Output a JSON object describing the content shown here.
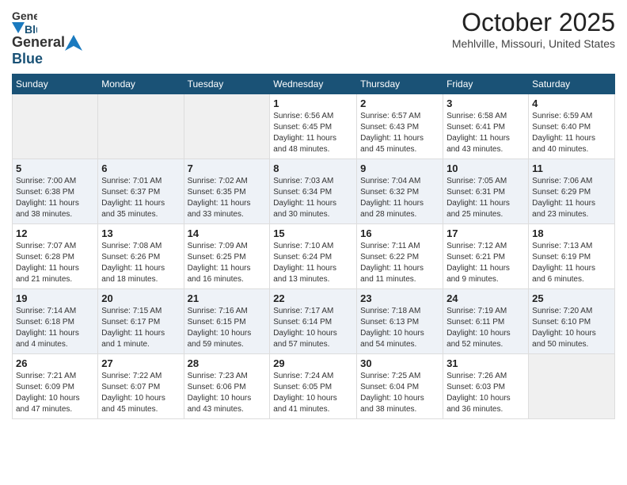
{
  "header": {
    "logo_general": "General",
    "logo_blue": "Blue",
    "month_title": "October 2025",
    "location": "Mehlville, Missouri, United States"
  },
  "days_of_week": [
    "Sunday",
    "Monday",
    "Tuesday",
    "Wednesday",
    "Thursday",
    "Friday",
    "Saturday"
  ],
  "weeks": [
    [
      {
        "day": "",
        "info": ""
      },
      {
        "day": "",
        "info": ""
      },
      {
        "day": "",
        "info": ""
      },
      {
        "day": "1",
        "info": "Sunrise: 6:56 AM\nSunset: 6:45 PM\nDaylight: 11 hours\nand 48 minutes."
      },
      {
        "day": "2",
        "info": "Sunrise: 6:57 AM\nSunset: 6:43 PM\nDaylight: 11 hours\nand 45 minutes."
      },
      {
        "day": "3",
        "info": "Sunrise: 6:58 AM\nSunset: 6:41 PM\nDaylight: 11 hours\nand 43 minutes."
      },
      {
        "day": "4",
        "info": "Sunrise: 6:59 AM\nSunset: 6:40 PM\nDaylight: 11 hours\nand 40 minutes."
      }
    ],
    [
      {
        "day": "5",
        "info": "Sunrise: 7:00 AM\nSunset: 6:38 PM\nDaylight: 11 hours\nand 38 minutes."
      },
      {
        "day": "6",
        "info": "Sunrise: 7:01 AM\nSunset: 6:37 PM\nDaylight: 11 hours\nand 35 minutes."
      },
      {
        "day": "7",
        "info": "Sunrise: 7:02 AM\nSunset: 6:35 PM\nDaylight: 11 hours\nand 33 minutes."
      },
      {
        "day": "8",
        "info": "Sunrise: 7:03 AM\nSunset: 6:34 PM\nDaylight: 11 hours\nand 30 minutes."
      },
      {
        "day": "9",
        "info": "Sunrise: 7:04 AM\nSunset: 6:32 PM\nDaylight: 11 hours\nand 28 minutes."
      },
      {
        "day": "10",
        "info": "Sunrise: 7:05 AM\nSunset: 6:31 PM\nDaylight: 11 hours\nand 25 minutes."
      },
      {
        "day": "11",
        "info": "Sunrise: 7:06 AM\nSunset: 6:29 PM\nDaylight: 11 hours\nand 23 minutes."
      }
    ],
    [
      {
        "day": "12",
        "info": "Sunrise: 7:07 AM\nSunset: 6:28 PM\nDaylight: 11 hours\nand 21 minutes."
      },
      {
        "day": "13",
        "info": "Sunrise: 7:08 AM\nSunset: 6:26 PM\nDaylight: 11 hours\nand 18 minutes."
      },
      {
        "day": "14",
        "info": "Sunrise: 7:09 AM\nSunset: 6:25 PM\nDaylight: 11 hours\nand 16 minutes."
      },
      {
        "day": "15",
        "info": "Sunrise: 7:10 AM\nSunset: 6:24 PM\nDaylight: 11 hours\nand 13 minutes."
      },
      {
        "day": "16",
        "info": "Sunrise: 7:11 AM\nSunset: 6:22 PM\nDaylight: 11 hours\nand 11 minutes."
      },
      {
        "day": "17",
        "info": "Sunrise: 7:12 AM\nSunset: 6:21 PM\nDaylight: 11 hours\nand 9 minutes."
      },
      {
        "day": "18",
        "info": "Sunrise: 7:13 AM\nSunset: 6:19 PM\nDaylight: 11 hours\nand 6 minutes."
      }
    ],
    [
      {
        "day": "19",
        "info": "Sunrise: 7:14 AM\nSunset: 6:18 PM\nDaylight: 11 hours\nand 4 minutes."
      },
      {
        "day": "20",
        "info": "Sunrise: 7:15 AM\nSunset: 6:17 PM\nDaylight: 11 hours\nand 1 minute."
      },
      {
        "day": "21",
        "info": "Sunrise: 7:16 AM\nSunset: 6:15 PM\nDaylight: 10 hours\nand 59 minutes."
      },
      {
        "day": "22",
        "info": "Sunrise: 7:17 AM\nSunset: 6:14 PM\nDaylight: 10 hours\nand 57 minutes."
      },
      {
        "day": "23",
        "info": "Sunrise: 7:18 AM\nSunset: 6:13 PM\nDaylight: 10 hours\nand 54 minutes."
      },
      {
        "day": "24",
        "info": "Sunrise: 7:19 AM\nSunset: 6:11 PM\nDaylight: 10 hours\nand 52 minutes."
      },
      {
        "day": "25",
        "info": "Sunrise: 7:20 AM\nSunset: 6:10 PM\nDaylight: 10 hours\nand 50 minutes."
      }
    ],
    [
      {
        "day": "26",
        "info": "Sunrise: 7:21 AM\nSunset: 6:09 PM\nDaylight: 10 hours\nand 47 minutes."
      },
      {
        "day": "27",
        "info": "Sunrise: 7:22 AM\nSunset: 6:07 PM\nDaylight: 10 hours\nand 45 minutes."
      },
      {
        "day": "28",
        "info": "Sunrise: 7:23 AM\nSunset: 6:06 PM\nDaylight: 10 hours\nand 43 minutes."
      },
      {
        "day": "29",
        "info": "Sunrise: 7:24 AM\nSunset: 6:05 PM\nDaylight: 10 hours\nand 41 minutes."
      },
      {
        "day": "30",
        "info": "Sunrise: 7:25 AM\nSunset: 6:04 PM\nDaylight: 10 hours\nand 38 minutes."
      },
      {
        "day": "31",
        "info": "Sunrise: 7:26 AM\nSunset: 6:03 PM\nDaylight: 10 hours\nand 36 minutes."
      },
      {
        "day": "",
        "info": ""
      }
    ]
  ]
}
